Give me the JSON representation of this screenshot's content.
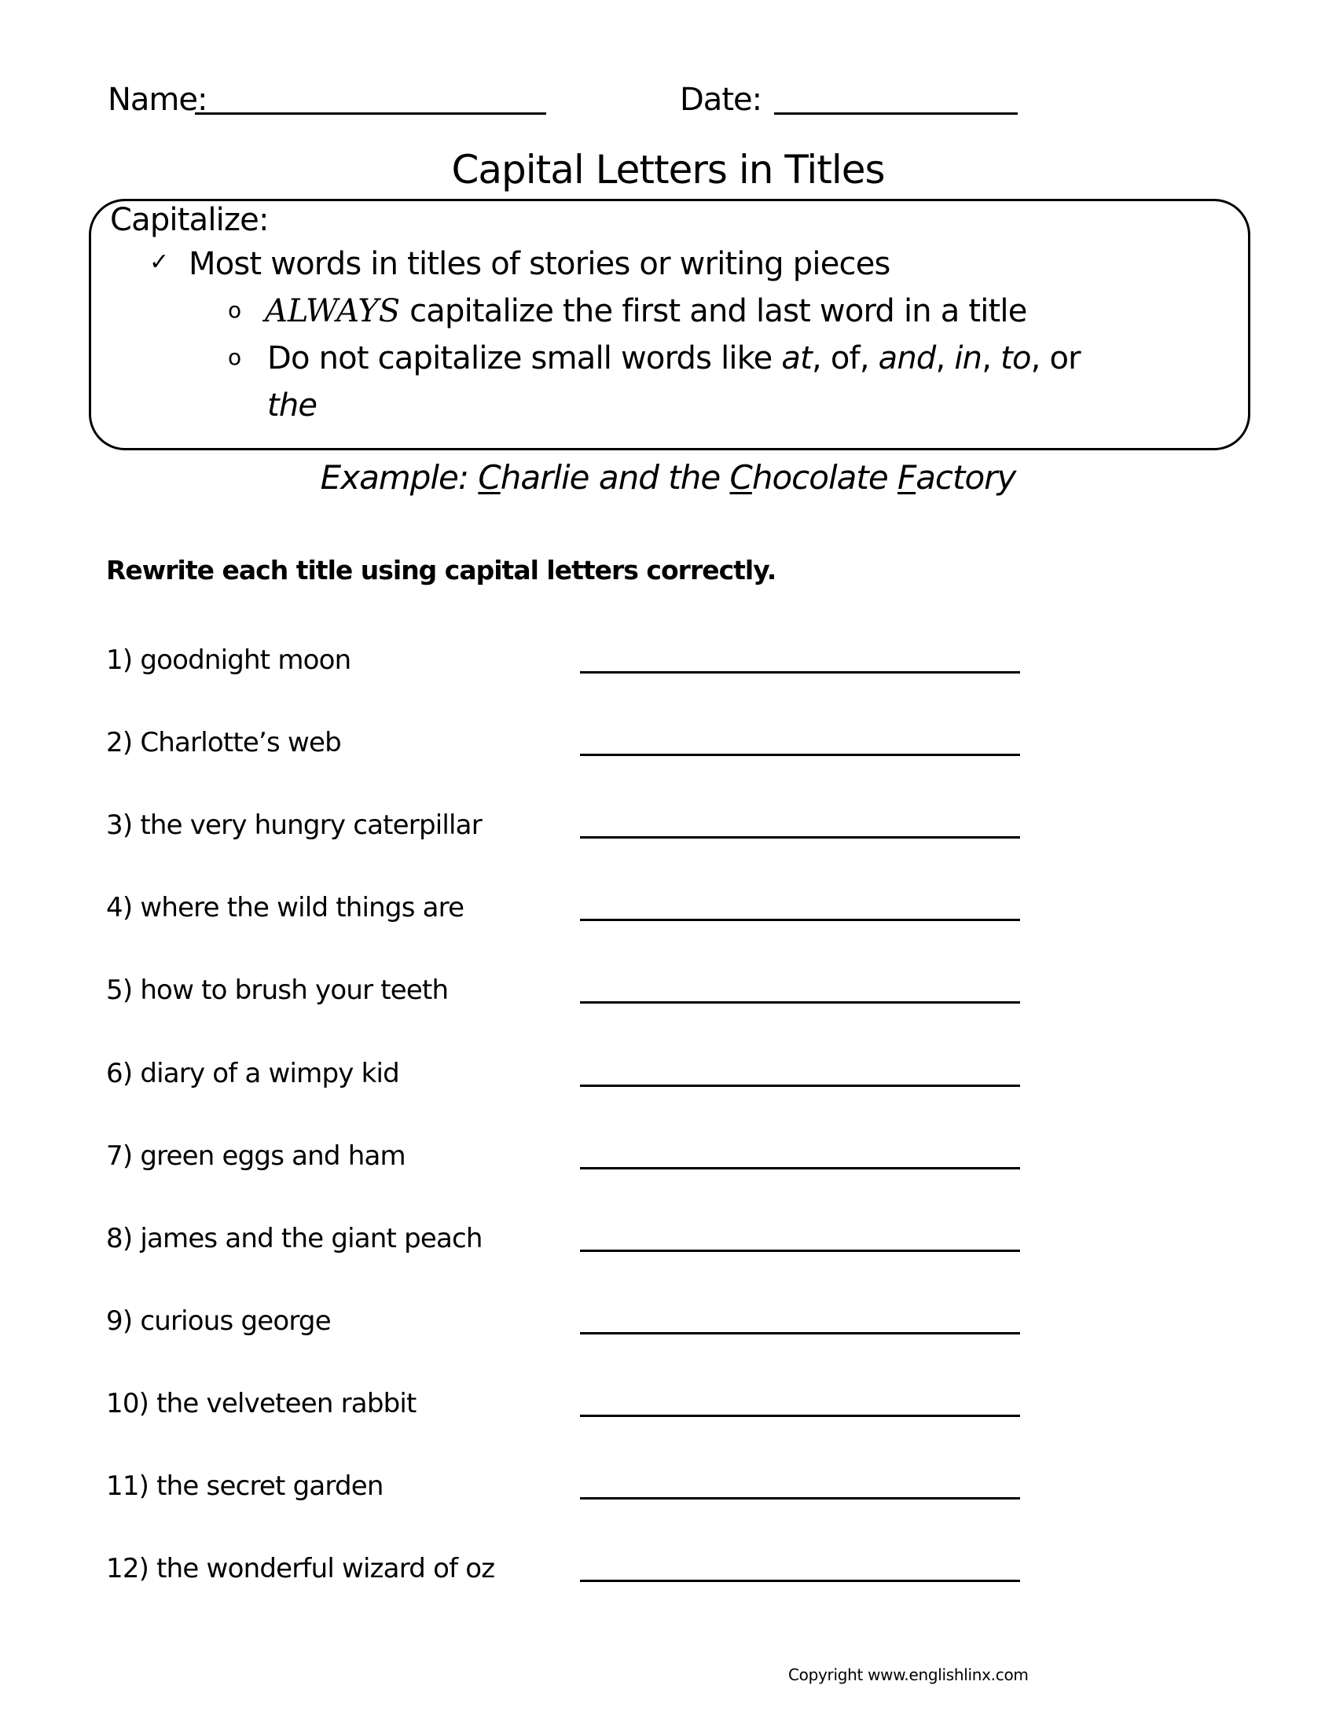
{
  "header": {
    "name_label": "Name:",
    "date_label": "Date:"
  },
  "title": "Capital Letters in Titles",
  "rule_box": {
    "heading": "Capitalize:",
    "check_icon": "✓",
    "rule_main": "Most words in titles of stories or writing pieces",
    "bullet_icon": "o",
    "sub_rule_1": {
      "emphasis": "ALWAYS",
      "text": " capitalize the first and last word in a title"
    },
    "sub_rule_2": {
      "prefix": "Do not capitalize small words like ",
      "w1": "at",
      "sep1": ", ",
      "w2": "of",
      "sep2": ", ",
      "w3": "and",
      "sep3": ", ",
      "w4": "in",
      "sep4": ", ",
      "w5": "to",
      "sep5": ", or",
      "w6": "the"
    }
  },
  "example": {
    "label": "Example: ",
    "parts": [
      "C",
      "harlie and the ",
      "C",
      "hocolate ",
      "F",
      "actory"
    ]
  },
  "instructions": "Rewrite each title using capital letters correctly.",
  "items": [
    {
      "number": "1)",
      "text": "goodnight moon",
      "answer": ""
    },
    {
      "number": "2)",
      "text": "Charlotte’s web",
      "answer": ""
    },
    {
      "number": "3)",
      "text": "the very hungry caterpillar",
      "answer": ""
    },
    {
      "number": "4)",
      "text": "where the wild things are",
      "answer": ""
    },
    {
      "number": "5)",
      "text": "how to brush your teeth",
      "answer": ""
    },
    {
      "number": "6)",
      "text": "diary of a wimpy kid",
      "answer": ""
    },
    {
      "number": "7)",
      "text": "green eggs and ham",
      "answer": ""
    },
    {
      "number": "8)",
      "text": "james and the giant peach",
      "answer": ""
    },
    {
      "number": "9)",
      "text": "curious george",
      "answer": ""
    },
    {
      "number": "10)",
      "text": "the velveteen rabbit",
      "answer": ""
    },
    {
      "number": "11)",
      "text": "the secret garden",
      "answer": ""
    },
    {
      "number": "12)",
      "text": "the wonderful wizard of oz",
      "answer": ""
    }
  ],
  "footer": {
    "copyright": "Copyright www.englishlinx.com"
  }
}
